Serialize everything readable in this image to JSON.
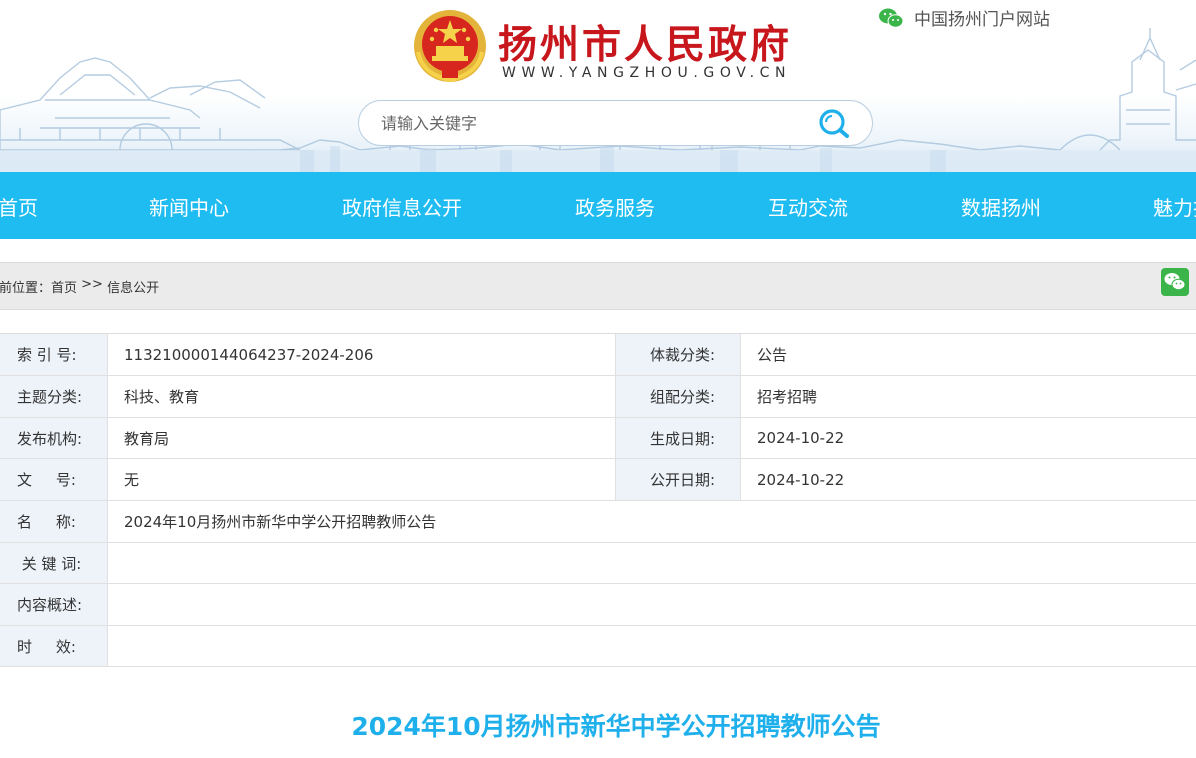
{
  "header": {
    "site_title": "扬州市人民政府",
    "site_url": "WWW.YANGZHOU.GOV.CN",
    "portal_link": "中国扬州门户网站",
    "emblem_icon": "national-emblem-icon",
    "portal_icon": "wechat-icon"
  },
  "search": {
    "placeholder": "请输入关键字",
    "button_icon": "search-icon"
  },
  "nav": {
    "items": [
      "首页",
      "新闻中心",
      "政府信息公开",
      "政务服务",
      "互动交流",
      "数据扬州",
      "魅力扬"
    ]
  },
  "breadcrumb": {
    "prefix": "前位置：",
    "home": "首页",
    "separator": " >> ",
    "current": "信息公开",
    "share_icon": "wechat-share-icon"
  },
  "info": {
    "index_label": "索 引 号:",
    "index_value": "113210000144064237-2024-206",
    "genre_label": "体裁分类:",
    "genre_value": "公告",
    "topic_label": "主题分类:",
    "topic_value": "科技、教育",
    "config_label": "组配分类:",
    "config_value": "招考招聘",
    "org_label": "发布机构:",
    "org_value": "教育局",
    "created_label": "生成日期:",
    "created_value": "2024-10-22",
    "doc_label": "文     号:",
    "doc_value": "无",
    "public_label": "公开日期:",
    "public_value": "2024-10-22",
    "name_label": "名     称:",
    "name_value": "2024年10月扬州市新华中学公开招聘教师公告",
    "keyword_label": " 关 键 词:",
    "keyword_value": "",
    "summary_label": "内容概述:",
    "summary_value": "",
    "validity_label": "时     效:",
    "validity_value": ""
  },
  "article": {
    "title": "2024年10月扬州市新华中学公开招聘教师公告"
  },
  "colors": {
    "nav_bg": "#1fbcf2",
    "title_red": "#c8161d",
    "article_title": "#1fb0ec",
    "label_bg": "#eef3f9",
    "wechat_green": "#3bb54a"
  }
}
